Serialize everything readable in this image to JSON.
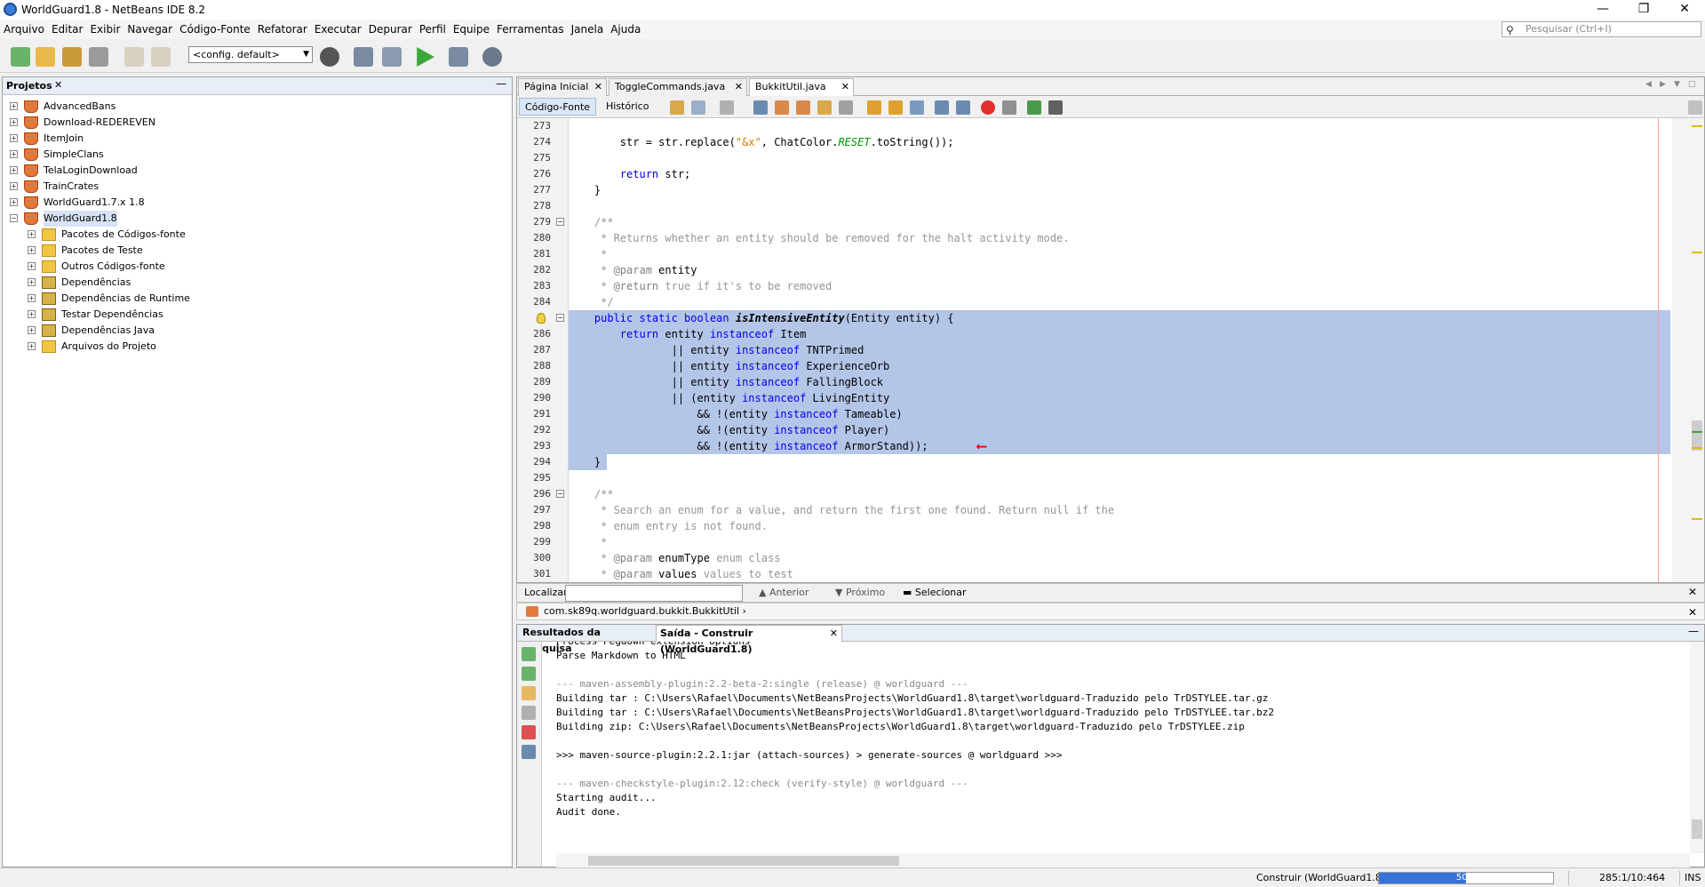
{
  "window": {
    "title": "WorldGuard1.8 - NetBeans IDE 8.2"
  },
  "menu": [
    "Arquivo",
    "Editar",
    "Exibir",
    "Navegar",
    "Código-Fonte",
    "Refatorar",
    "Executar",
    "Depurar",
    "Perfil",
    "Equipe",
    "Ferramentas",
    "Janela",
    "Ajuda"
  ],
  "search": {
    "placeholder": "Pesquisar (Ctrl+I)"
  },
  "toolbar": {
    "config": "<config. default>"
  },
  "projects": {
    "tab": "Projetos",
    "items": [
      {
        "label": "AdvancedBans",
        "level": 0,
        "icon": "coffee"
      },
      {
        "label": "Download-REDEREVEN",
        "level": 0,
        "icon": "coffee"
      },
      {
        "label": "ItemJoin",
        "level": 0,
        "icon": "coffee"
      },
      {
        "label": "SimpleClans",
        "level": 0,
        "icon": "coffee"
      },
      {
        "label": "TelaLoginDownload",
        "level": 0,
        "icon": "coffee"
      },
      {
        "label": "TrainCrates",
        "level": 0,
        "icon": "coffee"
      },
      {
        "label": "WorldGuard1.7.x 1.8",
        "level": 0,
        "icon": "coffee"
      },
      {
        "label": "WorldGuard1.8",
        "level": 0,
        "icon": "coffee",
        "expanded": true,
        "selected": true
      },
      {
        "label": "Pacotes de Códigos-fonte",
        "level": 1,
        "icon": "folder"
      },
      {
        "label": "Pacotes de Teste",
        "level": 1,
        "icon": "folder"
      },
      {
        "label": "Outros Códigos-fonte",
        "level": 1,
        "icon": "folder"
      },
      {
        "label": "Dependências",
        "level": 1,
        "icon": "jar"
      },
      {
        "label": "Dependências de Runtime",
        "level": 1,
        "icon": "jar"
      },
      {
        "label": "Testar Dependências",
        "level": 1,
        "icon": "jar"
      },
      {
        "label": "Dependências Java",
        "level": 1,
        "icon": "jar"
      },
      {
        "label": "Arquivos do Projeto",
        "level": 1,
        "icon": "folder"
      }
    ]
  },
  "editor": {
    "tabs": [
      {
        "label": "Página Inicial",
        "active": false
      },
      {
        "label": "ToggleCommands.java",
        "active": false
      },
      {
        "label": "BukkitUtil.java",
        "active": true
      }
    ],
    "views": {
      "source": "Código-Fonte",
      "history": "Histórico"
    },
    "lines": [
      {
        "n": "273",
        "html": ""
      },
      {
        "n": "274",
        "html": "        str = str.replace(<span class=\"str\">\"&amp;x\"</span>, ChatColor.<span class=\"fld\">RESET</span>.toString());"
      },
      {
        "n": "275",
        "html": ""
      },
      {
        "n": "276",
        "html": "        <span class=\"kw\">return</span> str;"
      },
      {
        "n": "277",
        "html": "    }"
      },
      {
        "n": "278",
        "html": ""
      },
      {
        "n": "279",
        "html": "    <span class=\"cm\">/**</span>",
        "fold": true
      },
      {
        "n": "280",
        "html": "<span class=\"cm\">     * Returns whether an entity should be removed for the halt activity mode.</span>"
      },
      {
        "n": "281",
        "html": "<span class=\"cm\">     *</span>"
      },
      {
        "n": "282",
        "html": "<span class=\"cm\">     * </span><span class=\"tag\">@param</span> entity"
      },
      {
        "n": "283",
        "html": "<span class=\"cm\">     * </span><span class=\"tag\">@return</span><span class=\"cm\"> true if it's to be removed</span>"
      },
      {
        "n": "284",
        "html": "<span class=\"cm\">     */</span>"
      },
      {
        "n": "",
        "html": "    <span class=\"kw\">public static boolean</span> <span class=\"meth\">isIntensiveEntity</span>(Entity entity) {",
        "sel": true,
        "fold": true,
        "bulb": true
      },
      {
        "n": "286",
        "html": "        <span class=\"kw\">return</span> entity <span class=\"kw\">instanceof</span> Item",
        "sel": true
      },
      {
        "n": "287",
        "html": "                || entity <span class=\"kw\">instanceof</span> TNTPrimed",
        "sel": true
      },
      {
        "n": "288",
        "html": "                || entity <span class=\"kw\">instanceof</span> ExperienceOrb",
        "sel": true
      },
      {
        "n": "289",
        "html": "                || entity <span class=\"kw\">instanceof</span> FallingBlock",
        "sel": true
      },
      {
        "n": "290",
        "html": "                || (entity <span class=\"kw\">instanceof</span> LivingEntity",
        "sel": true
      },
      {
        "n": "291",
        "html": "                    &amp;&amp; !(entity <span class=\"kw\">instanceof</span> Tameable)",
        "sel": true
      },
      {
        "n": "292",
        "html": "                    &amp;&amp; !(entity <span class=\"kw\">instanceof</span> Player)",
        "sel": true
      },
      {
        "n": "293",
        "html": "                    &amp;&amp; !(entity <span class=\"kw\">instanceof</span> ArmorStand));",
        "sel": true,
        "arrow": true
      },
      {
        "n": "294",
        "html": "    }",
        "partsel": true
      },
      {
        "n": "295",
        "html": ""
      },
      {
        "n": "296",
        "html": "    <span class=\"cm\">/**</span>",
        "fold": true
      },
      {
        "n": "297",
        "html": "<span class=\"cm\">     * Search an enum for a value, and return the first one found. Return null if the</span>"
      },
      {
        "n": "298",
        "html": "<span class=\"cm\">     * enum entry is not found.</span>"
      },
      {
        "n": "299",
        "html": "<span class=\"cm\">     *</span>"
      },
      {
        "n": "300",
        "html": "<span class=\"cm\">     * </span><span class=\"tag\">@param</span> enumType<span class=\"cm\"> enum class</span>"
      },
      {
        "n": "301",
        "html": "<span class=\"cm\">     * </span><span class=\"tag\">@param</span> values<span class=\"cm\"> values to test</span>"
      }
    ]
  },
  "find": {
    "label": "Localizar:",
    "prev": "Anterior",
    "next": "Próximo",
    "select": "Selecionar"
  },
  "breadcrumb": "com.sk89q.worldguard.bukkit.BukkitUtil",
  "output": {
    "tabs": [
      {
        "label": "Resultados da Pesquisa",
        "active": false
      },
      {
        "label": "Saída - Construir (WorldGuard1.8)",
        "active": true
      }
    ],
    "lines": [
      {
        "t": "Process Pegdown extension options",
        "cut": true
      },
      {
        "t": "Parse Markdown to HTML"
      },
      {
        "t": ""
      },
      {
        "t": "--- maven-assembly-plugin:2.2-beta-2:single (release) @ worldguard ---",
        "dim": true,
        "fold": true
      },
      {
        "t": "Building tar : C:\\Users\\Rafael\\Documents\\NetBeansProjects\\WorldGuard1.8\\target\\worldguard-Traduzido pelo TrDSTYLEE.tar.gz"
      },
      {
        "t": "Building tar : C:\\Users\\Rafael\\Documents\\NetBeansProjects\\WorldGuard1.8\\target\\worldguard-Traduzido pelo TrDSTYLEE.tar.bz2"
      },
      {
        "t": "Building zip: C:\\Users\\Rafael\\Documents\\NetBeansProjects\\WorldGuard1.8\\target\\worldguard-Traduzido pelo TrDSTYLEE.zip"
      },
      {
        "t": ""
      },
      {
        "t": ">>> maven-source-plugin:2.2.1:jar (attach-sources) > generate-sources @ worldguard >>>"
      },
      {
        "t": ""
      },
      {
        "t": "--- maven-checkstyle-plugin:2.12:check (verify-style) @ worldguard ---",
        "dim": true,
        "fold": true
      },
      {
        "t": "Starting audit..."
      },
      {
        "t": "Audit done."
      }
    ]
  },
  "status": {
    "task": "Construir (WorldGuard1.8)",
    "progress": 50,
    "progress_label": "50%",
    "position": "285:1/10:464",
    "mode": "INS"
  }
}
